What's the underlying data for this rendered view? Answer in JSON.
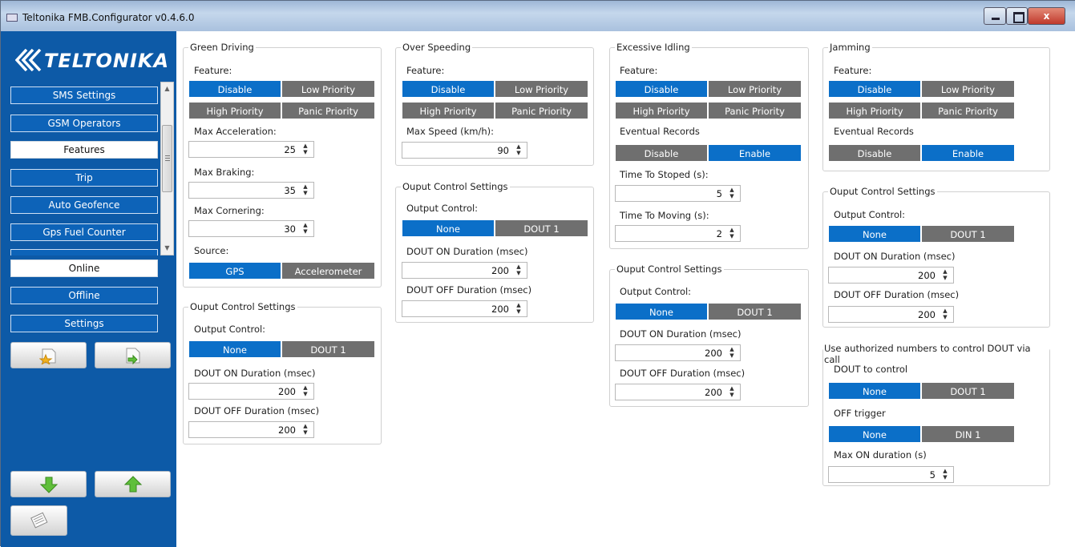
{
  "window": {
    "title": "Teltonika FMB.Configurator v0.4.6.0",
    "close_label": "x"
  },
  "sidebar": {
    "logo_text": "TELTONIKA",
    "nav_items": [
      {
        "label": "SMS Settings"
      },
      {
        "label": "GSM Operators"
      },
      {
        "label": "Features"
      },
      {
        "label": "Trip"
      },
      {
        "label": "Auto Geofence"
      },
      {
        "label": "Gps Fuel Counter"
      }
    ],
    "mode_items": [
      {
        "label": "Online"
      },
      {
        "label": "Offline"
      },
      {
        "label": "Settings"
      }
    ]
  },
  "green_driving": {
    "title": "Green Driving",
    "feature_label": "Feature:",
    "feature_options": [
      "Disable",
      "Low Priority",
      "High Priority",
      "Panic Priority"
    ],
    "feature_selected": "Disable",
    "max_acceleration_label": "Max Acceleration:",
    "max_acceleration": "25",
    "max_braking_label": "Max Braking:",
    "max_braking": "35",
    "max_cornering_label": "Max Cornering:",
    "max_cornering": "30",
    "source_label": "Source:",
    "source_options": [
      "GPS",
      "Accelerometer"
    ],
    "source_selected": "GPS"
  },
  "green_driving_output": {
    "title": "Ouput Control Settings",
    "output_label": "Output Control:",
    "output_options": [
      "None",
      "DOUT 1"
    ],
    "on_label": "DOUT ON Duration (msec)",
    "on_value": "200",
    "off_label": "DOUT OFF Duration (msec)",
    "off_value": "200"
  },
  "over_speeding": {
    "title": "Over Speeding",
    "feature_label": "Feature:",
    "feature_options": [
      "Disable",
      "Low Priority",
      "High Priority",
      "Panic Priority"
    ],
    "max_speed_label": "Max Speed (km/h):",
    "max_speed": "90"
  },
  "over_speeding_output": {
    "title": "Ouput Control Settings",
    "output_label": "Output Control:",
    "output_options": [
      "None",
      "DOUT 1"
    ],
    "on_label": "DOUT ON Duration (msec)",
    "on_value": "200",
    "off_label": "DOUT OFF Duration (msec)",
    "off_value": "200"
  },
  "excessive_idling": {
    "title": "Excessive Idling",
    "feature_label": "Feature:",
    "feature_options": [
      "Disable",
      "Low Priority",
      "High Priority",
      "Panic Priority"
    ],
    "eventual_label": "Eventual Records",
    "eventual_options": [
      "Disable",
      "Enable"
    ],
    "time_stoped_label": "Time To Stoped (s):",
    "time_stoped": "5",
    "time_moving_label": "Time To Moving (s):",
    "time_moving": "2"
  },
  "excessive_idling_output": {
    "title": "Ouput Control Settings",
    "output_label": "Output Control:",
    "output_options": [
      "None",
      "DOUT 1"
    ],
    "on_label": "DOUT ON Duration (msec)",
    "on_value": "200",
    "off_label": "DOUT OFF Duration (msec)",
    "off_value": "200"
  },
  "jamming": {
    "title": "Jamming",
    "feature_label": "Feature:",
    "feature_options": [
      "Disable",
      "Low Priority",
      "High Priority",
      "Panic Priority"
    ],
    "eventual_label": "Eventual Records",
    "eventual_options": [
      "Disable",
      "Enable"
    ]
  },
  "jamming_output": {
    "title": "Ouput Control Settings",
    "output_label": "Output Control:",
    "output_options": [
      "None",
      "DOUT 1"
    ],
    "on_label": "DOUT ON Duration (msec)",
    "on_value": "200",
    "off_label": "DOUT OFF Duration (msec)",
    "off_value": "200"
  },
  "authorized_call": {
    "title": "Use authorized numbers to control DOUT via call",
    "dout_label": "DOUT to control",
    "dout_options": [
      "None",
      "DOUT 1"
    ],
    "off_trigger_label": "OFF trigger",
    "off_trigger_options": [
      "None",
      "DIN 1"
    ],
    "max_on_label": "Max ON duration (s)",
    "max_on_value": "5"
  },
  "colors": {
    "sidebar": "#0d5aa7",
    "selected": "#0b6fc8",
    "unselected": "#6f6f6f"
  },
  "icons": [
    "star-folder-icon",
    "export-icon",
    "download-arrow-icon",
    "upload-arrow-icon",
    "document-icon",
    "teltonika-logo-icon"
  ]
}
